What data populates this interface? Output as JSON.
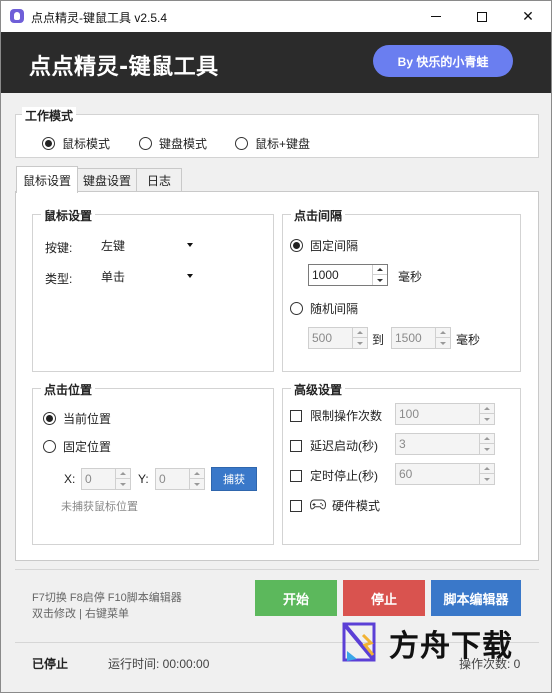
{
  "window": {
    "title": "点点精灵-键鼠工具 v2.5.4",
    "controls": {
      "minimize": "minimize",
      "maximize": "maximize",
      "close": "✕"
    }
  },
  "header": {
    "title": "点点精灵-键鼠工具",
    "author": "By 快乐的小青蛙",
    "bg_color": "#2b2b2b",
    "badge_color": "#6a7ef0"
  },
  "work_mode": {
    "legend": "工作模式",
    "options": [
      {
        "label": "鼠标模式",
        "selected": true
      },
      {
        "label": "键盘模式",
        "selected": false
      },
      {
        "label": "鼠标+键盘",
        "selected": false
      }
    ]
  },
  "tabs": [
    {
      "label": "鼠标设置",
      "active": true
    },
    {
      "label": "键盘设置",
      "active": false
    },
    {
      "label": "日志",
      "active": false
    }
  ],
  "mouse_settings": {
    "legend": "鼠标设置",
    "button_label": "按键:",
    "button_value": "左键",
    "type_label": "类型:",
    "type_value": "单击"
  },
  "click_interval": {
    "legend": "点击间隔",
    "fixed_label": "固定间隔",
    "fixed_selected": true,
    "fixed_value": "1000",
    "unit_ms": "毫秒",
    "random_label": "随机间隔",
    "random_selected": false,
    "random_min": "500",
    "random_to": "到",
    "random_max": "1500",
    "random_unit": "毫秒"
  },
  "click_position": {
    "legend": "点击位置",
    "current_label": "当前位置",
    "current_selected": true,
    "fixed_label": "固定位置",
    "fixed_selected": false,
    "x_label": "X:",
    "x_value": "0",
    "y_label": "Y:",
    "y_value": "0",
    "capture_button": "捕获",
    "hint": "未捕获鼠标位置"
  },
  "advanced": {
    "legend": "高级设置",
    "items": [
      {
        "label": "限制操作次数",
        "checked": false,
        "value": "100"
      },
      {
        "label": "延迟启动(秒)",
        "checked": false,
        "value": "3"
      },
      {
        "label": "定时停止(秒)",
        "checked": false,
        "value": "60"
      }
    ],
    "hardware_label": "硬件模式",
    "hardware_checked": false
  },
  "footer": {
    "hotkeys": "F7切换 F8启停 F10脚本编辑器",
    "tips": "双击修改 | 右键菜单",
    "start_button": "开始",
    "stop_button": "停止",
    "editor_button": "脚本编辑器",
    "colors": {
      "start": "#5cb85c",
      "stop": "#d9534f",
      "editor": "#3a78c9"
    }
  },
  "status": {
    "state": "已停止",
    "run_time": "运行时间: 00:00:00",
    "op_count": "操作次数: 0"
  },
  "watermark": {
    "text": "方舟下载"
  }
}
